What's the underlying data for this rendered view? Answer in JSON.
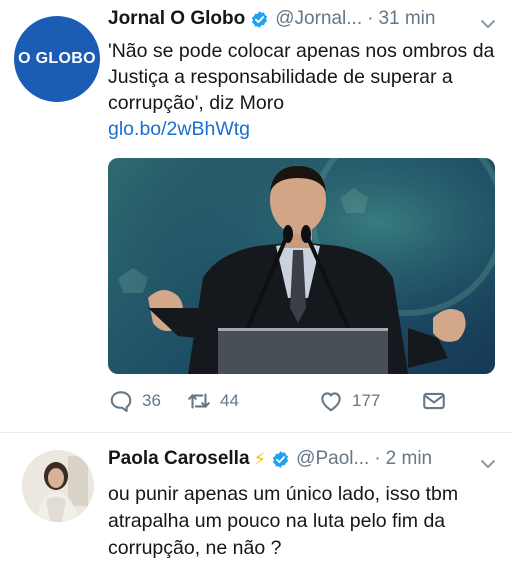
{
  "tweets": [
    {
      "avatar_text": "O GLOBO",
      "name": "Jornal O Globo",
      "handle": "@Jornal...",
      "separator": "·",
      "time": "31 min",
      "text": "'Não se pode colocar apenas nos ombros da Justiça a responsabilidade de superar a corrupção', diz Moro",
      "link": "glo.bo/2wBhWtg",
      "actions": {
        "replies": "36",
        "retweets": "44",
        "likes": "177"
      }
    },
    {
      "name": "Paola Carosella",
      "handle": "@Paol...",
      "separator": "·",
      "time": "2 min",
      "text": "ou punir apenas um único lado, isso tbm atrapalha um pouco na luta pelo fim da corrupção, ne não ?"
    }
  ],
  "colors": {
    "verified": "#1da1f2",
    "link": "#1b6fcf",
    "muted": "#657786",
    "globo_blue": "#1b5cb5",
    "bolt": "#f5c400"
  }
}
